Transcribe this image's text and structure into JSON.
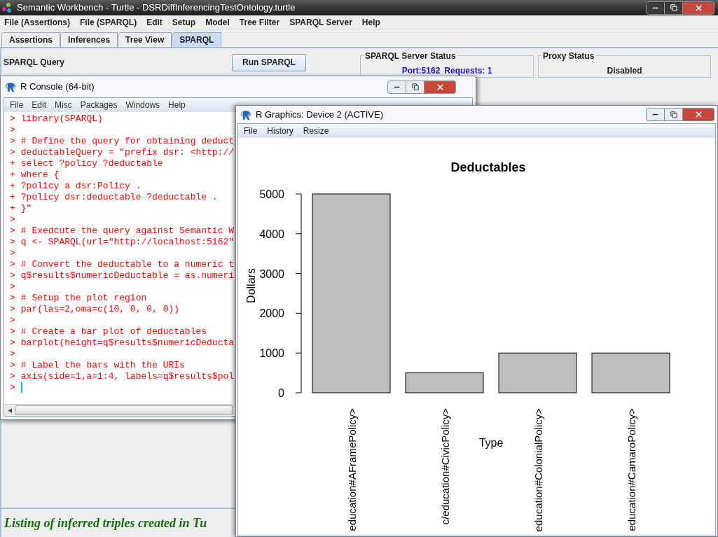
{
  "main_window": {
    "title": "Semantic Workbench - Turtle - DSRDiffInferencingTestOntology.turtle",
    "menu": [
      "File (Assertions)",
      "File (SPARQL)",
      "Edit",
      "Setup",
      "Model",
      "Tree Filter",
      "SPARQL Server",
      "Help"
    ],
    "tabs": [
      {
        "label": "Assertions",
        "selected": false
      },
      {
        "label": "Inferences",
        "selected": false
      },
      {
        "label": "Tree View",
        "selected": false
      },
      {
        "label": "SPARQL",
        "selected": true
      }
    ],
    "query_label": "SPARQL Query",
    "run_button": "Run SPARQL",
    "server_status": {
      "title": "SPARQL Server Status",
      "port": "Port:5162",
      "requests": "Requests: 1"
    },
    "proxy_status": {
      "title": "Proxy Status",
      "value": "Disabled"
    },
    "footer_heading": "Listing of inferred triples created in Tu"
  },
  "r_console": {
    "title": "R Console (64-bit)",
    "menu": [
      "File",
      "Edit",
      "Misc",
      "Packages",
      "Windows",
      "Help"
    ],
    "lines": [
      {
        "prompt": ">",
        "text": "library(SPARQL)"
      },
      {
        "prompt": ">"
      },
      {
        "prompt": ">",
        "text": "# Define the query for obtaining deduct"
      },
      {
        "prompt": ">",
        "text": "deductableQuery = \"prefix dsr: <http://"
      },
      {
        "prompt": "+",
        "text": "select ?policy ?deductable"
      },
      {
        "prompt": "+",
        "text": "where {"
      },
      {
        "prompt": "+",
        "text": "?policy a dsr:Policy ."
      },
      {
        "prompt": "+",
        "text": "?policy dsr:deductable ?deductable ."
      },
      {
        "prompt": "+",
        "text": "}\""
      },
      {
        "prompt": ">"
      },
      {
        "prompt": ">",
        "text": "# Exedcute the query against Semantic W"
      },
      {
        "prompt": ">",
        "text": "q <- SPARQL(url=\"http://localhost:5162\""
      },
      {
        "prompt": ">"
      },
      {
        "prompt": ">",
        "text": "# Convert the deductable to a numeric t"
      },
      {
        "prompt": ">",
        "text": "q$results$numericDeductable = as.numeri"
      },
      {
        "prompt": ">"
      },
      {
        "prompt": ">",
        "text": "# Setup the plot region"
      },
      {
        "prompt": ">",
        "text": "par(las=2,oma=c(10, 0, 0, 0))"
      },
      {
        "prompt": ">"
      },
      {
        "prompt": ">",
        "text": "# Create a bar plot of deductables"
      },
      {
        "prompt": ">",
        "text": "barplot(height=q$results$numericDeducta"
      },
      {
        "prompt": ">"
      },
      {
        "prompt": ">",
        "text": "# Label the bars with the URIs"
      },
      {
        "prompt": ">",
        "text": "axis(side=1,a=1:4, labels=q$results$pol"
      },
      {
        "prompt": ">",
        "cursor": true
      }
    ]
  },
  "r_graphics": {
    "title": "R Graphics: Device 2 (ACTIVE)",
    "menu": [
      "File",
      "History",
      "Resize"
    ],
    "chart_data": {
      "type": "bar",
      "title": "Deductables",
      "xlabel": "Type",
      "ylabel": "Dollars",
      "categories": [
        "education#AFramePolicy>",
        "c/education#CivicPolicy>",
        "education#ColonialPolicy>",
        "education#CamaroPolicy>"
      ],
      "values": [
        5000,
        500,
        1000,
        1000
      ],
      "ylim": [
        0,
        5000
      ],
      "yticks": [
        0,
        1000,
        2000,
        3000,
        4000,
        5000
      ]
    }
  }
}
